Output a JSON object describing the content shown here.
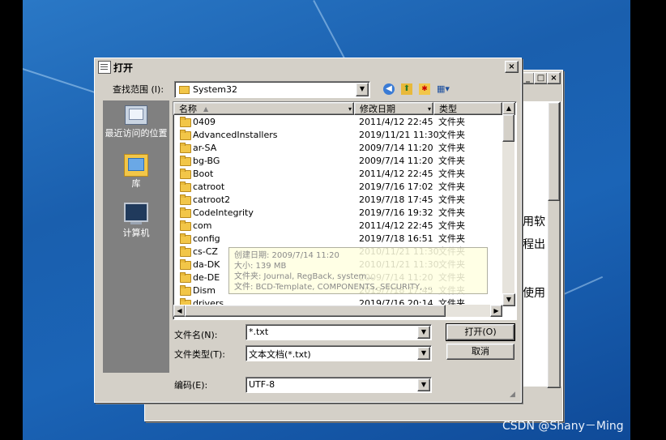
{
  "dialog": {
    "title": "打开",
    "lookin_label": "查找范围 (I):",
    "lookin_value": "System32"
  },
  "places": [
    {
      "label": "最近访问的位置",
      "icon": "recent-places-icon"
    },
    {
      "label": "库",
      "icon": "libraries-icon"
    },
    {
      "label": "计算机",
      "icon": "computer-icon"
    }
  ],
  "columns": {
    "name": "名称",
    "date": "修改日期",
    "type": "类型"
  },
  "files": [
    {
      "name": "0409",
      "date": "2011/4/12 22:45",
      "type": "文件夹"
    },
    {
      "name": "AdvancedInstallers",
      "date": "2019/11/21 11:30",
      "type": "文件夹"
    },
    {
      "name": "ar-SA",
      "date": "2009/7/14 11:20",
      "type": "文件夹"
    },
    {
      "name": "bg-BG",
      "date": "2009/7/14 11:20",
      "type": "文件夹"
    },
    {
      "name": "Boot",
      "date": "2011/4/12 22:45",
      "type": "文件夹"
    },
    {
      "name": "catroot",
      "date": "2019/7/16 17:02",
      "type": "文件夹"
    },
    {
      "name": "catroot2",
      "date": "2019/7/18 17:45",
      "type": "文件夹"
    },
    {
      "name": "CodeIntegrity",
      "date": "2019/7/16 19:32",
      "type": "文件夹"
    },
    {
      "name": "com",
      "date": "2011/4/12 22:45",
      "type": "文件夹"
    },
    {
      "name": "config",
      "date": "2019/7/18 16:51",
      "type": "文件夹"
    },
    {
      "name": "cs-CZ",
      "date": "2010/11/21 11:30",
      "type": "文件夹"
    },
    {
      "name": "da-DK",
      "date": "2010/11/21 11:30",
      "type": "文件夹"
    },
    {
      "name": "de-DE",
      "date": "2009/7/14 11:20",
      "type": "文件夹"
    },
    {
      "name": "Dism",
      "date": "2019/7/18 17:45",
      "type": "文件夹"
    },
    {
      "name": "drivers",
      "date": "2019/7/16 20:14",
      "type": "文件夹"
    }
  ],
  "tooltip": {
    "line1": "创建日期: 2009/7/14 11:20",
    "line2": "大小: 139 MB",
    "line3": "文件夹: Journal, RegBack, system...",
    "line4": "文件: BCD-Template, COMPONENTS, SECURITY, ..."
  },
  "filename": {
    "label": "文件名(N):",
    "value": "*.txt"
  },
  "filetype": {
    "label": "文件类型(T):",
    "value": "文本文档(*.txt)"
  },
  "encoding": {
    "label": "编码(E):",
    "value": "UTF-8"
  },
  "buttons": {
    "open": "打开(O)",
    "cancel": "取消",
    "close": "×",
    "min": "_",
    "max": "□"
  },
  "background_window": {
    "text1": "用软",
    "text2": "程出",
    "text3": "使用"
  },
  "watermark": "CSDN @Shany－Ming"
}
